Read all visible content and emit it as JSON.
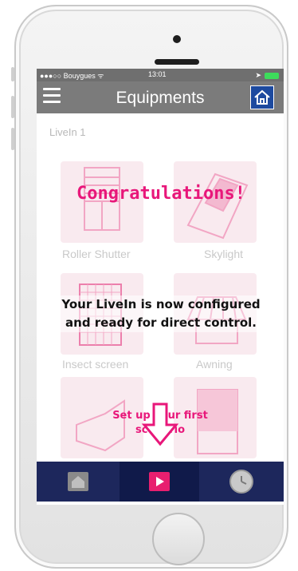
{
  "status_bar": {
    "carrier": "●●●○○ Bouygues ᯤ",
    "time": "13:01"
  },
  "nav": {
    "title": "Equipments"
  },
  "device": {
    "name": "LiveIn 1"
  },
  "equipment_tiles": [
    {
      "label": "Roller Shutter",
      "icon": "roller-shutter-icon"
    },
    {
      "label": "Skylight",
      "icon": "skylight-icon"
    },
    {
      "label": "Insect screen",
      "icon": "insect-screen-icon"
    },
    {
      "label": "Awning",
      "icon": "awning-icon"
    },
    {
      "label": "",
      "icon": "canopy-icon"
    },
    {
      "label": "",
      "icon": "blind-icon"
    }
  ],
  "overlay": {
    "title": "Congratulations!",
    "message": "Your LiveIn is now configured and ready for direct control.",
    "cta": "Set up your first scenario"
  },
  "tabbar": {
    "tabs": [
      {
        "icon": "home-icon",
        "active": false
      },
      {
        "icon": "play-icon",
        "active": true
      },
      {
        "icon": "clock-icon",
        "active": false
      }
    ]
  },
  "colors": {
    "accent": "#e8177a",
    "nav_bg": "#7b7b7b",
    "tab_bg": "#1d275c",
    "tile_bg": "#f9eaef"
  }
}
